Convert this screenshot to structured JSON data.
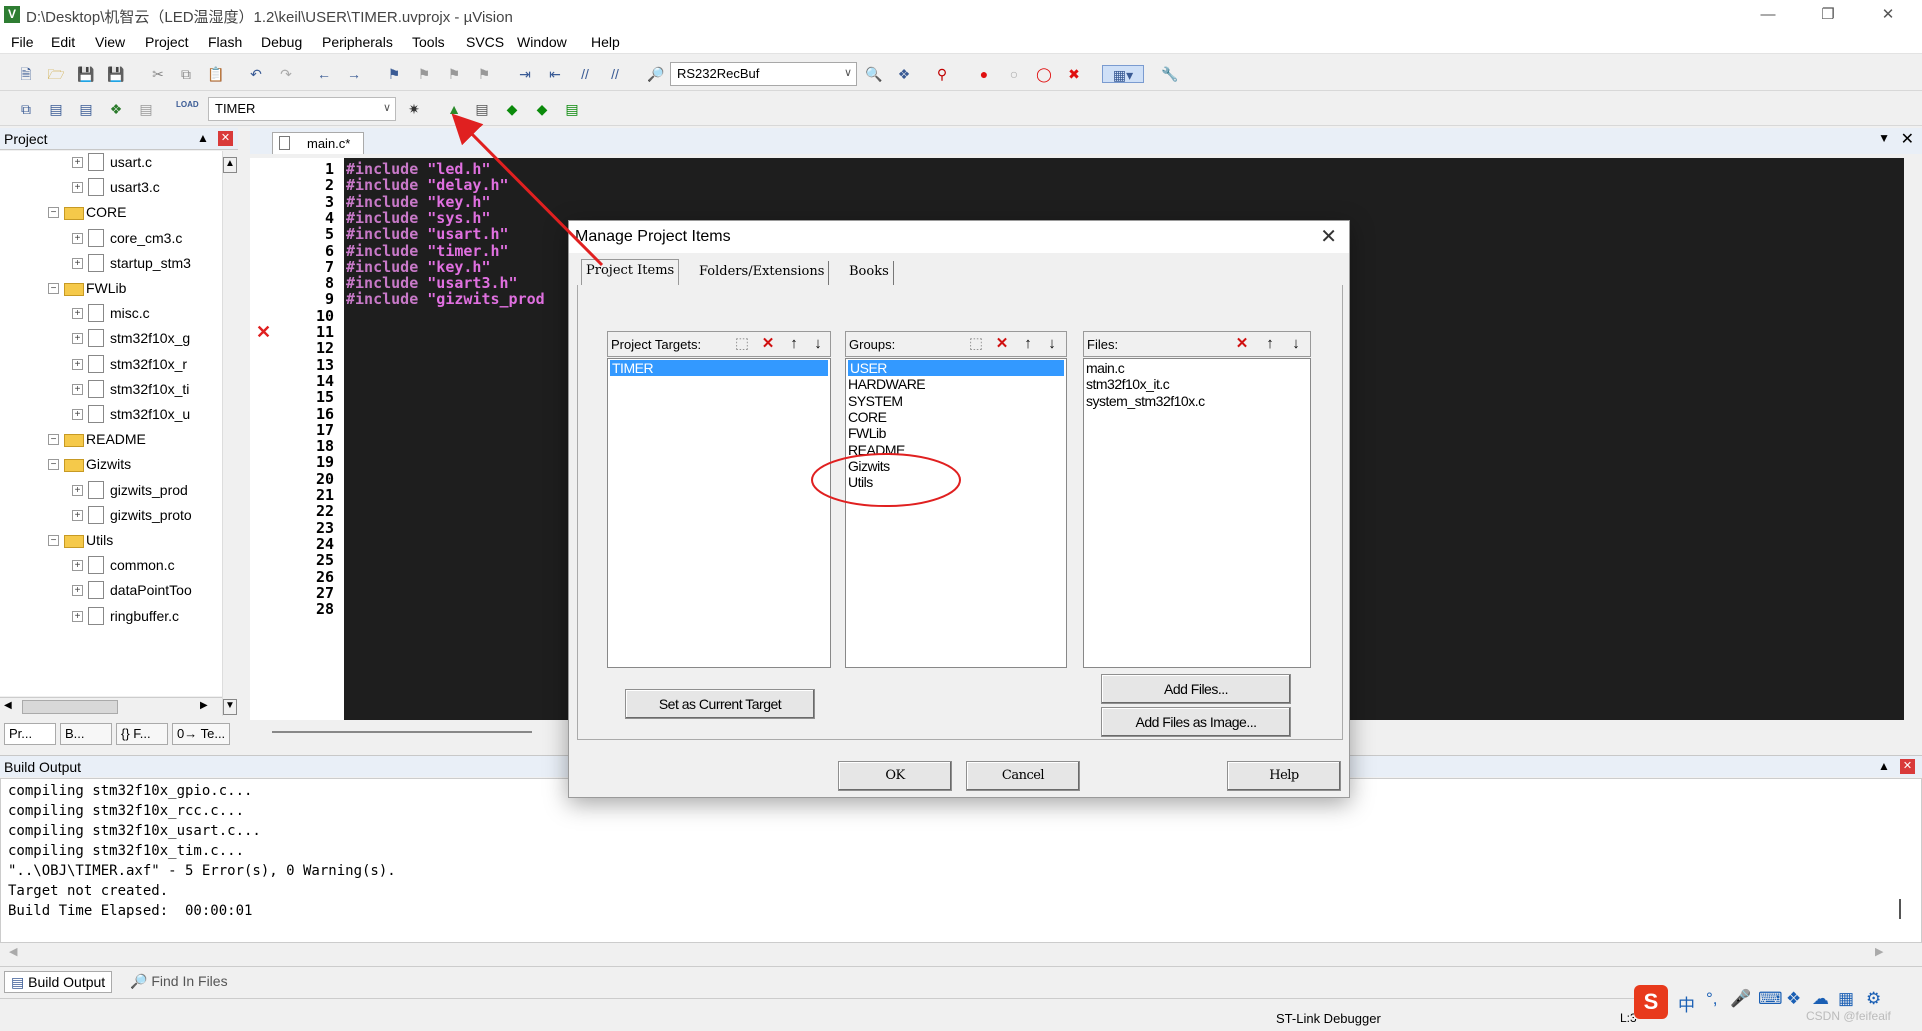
{
  "title_bar": {
    "title": "D:\\Desktop\\机智云（LED温湿度）1.2\\keil\\USER\\TIMER.uvprojx - µVision"
  },
  "menu": [
    "File",
    "Edit",
    "View",
    "Project",
    "Flash",
    "Debug",
    "Peripherals",
    "Tools",
    "SVCS",
    "Window",
    "Help"
  ],
  "toolbar": {
    "find_combo": "RS232RecBuf",
    "target_combo": "TIMER",
    "load_label": "LOAD"
  },
  "project_pane": {
    "title": "Project",
    "tree": [
      {
        "label": "usart.c",
        "level": 2,
        "kind": "file"
      },
      {
        "label": "usart3.c",
        "level": 2,
        "kind": "file"
      },
      {
        "label": "CORE",
        "level": 1,
        "kind": "folder"
      },
      {
        "label": "core_cm3.c",
        "level": 2,
        "kind": "file"
      },
      {
        "label": "startup_stm3",
        "level": 2,
        "kind": "file"
      },
      {
        "label": "FWLib",
        "level": 1,
        "kind": "folder"
      },
      {
        "label": "misc.c",
        "level": 2,
        "kind": "file"
      },
      {
        "label": "stm32f10x_g",
        "level": 2,
        "kind": "file"
      },
      {
        "label": "stm32f10x_r",
        "level": 2,
        "kind": "file"
      },
      {
        "label": "stm32f10x_ti",
        "level": 2,
        "kind": "file"
      },
      {
        "label": "stm32f10x_u",
        "level": 2,
        "kind": "file"
      },
      {
        "label": "README",
        "level": 1,
        "kind": "folder"
      },
      {
        "label": "Gizwits",
        "level": 1,
        "kind": "folder"
      },
      {
        "label": "gizwits_prod",
        "level": 2,
        "kind": "file"
      },
      {
        "label": "gizwits_proto",
        "level": 2,
        "kind": "file"
      },
      {
        "label": "Utils",
        "level": 1,
        "kind": "folder"
      },
      {
        "label": "common.c",
        "level": 2,
        "kind": "file"
      },
      {
        "label": "dataPointToo",
        "level": 2,
        "kind": "file"
      },
      {
        "label": "ringbuffer.c",
        "level": 2,
        "kind": "file"
      }
    ],
    "tabs": [
      "Pr...",
      "B...",
      "{} F...",
      "0→ Te..."
    ]
  },
  "editor": {
    "tab": "main.c*",
    "lines": [
      {
        "n": "1",
        "kw": "#include",
        "str": "\"led.h\""
      },
      {
        "n": "2",
        "kw": "#include",
        "str": "\"delay.h\""
      },
      {
        "n": "3",
        "kw": "#include",
        "str": "\"key.h\""
      },
      {
        "n": "4",
        "kw": "#include",
        "str": "\"sys.h\""
      },
      {
        "n": "5",
        "kw": "#include",
        "str": "\"usart.h\""
      },
      {
        "n": "6",
        "kw": "#include",
        "str": "\"timer.h\""
      },
      {
        "n": "7",
        "kw": "#include",
        "str": "\"key.h\""
      },
      {
        "n": "8",
        "kw": "#include",
        "str": "\"usart3.h\""
      },
      {
        "n": "9",
        "kw": "#include",
        "str": "\"gizwits_prod"
      },
      {
        "n": "10"
      },
      {
        "n": "11"
      },
      {
        "n": "12"
      },
      {
        "n": "13"
      },
      {
        "n": "14"
      },
      {
        "n": "15"
      },
      {
        "n": "16"
      },
      {
        "n": "17"
      },
      {
        "n": "18"
      },
      {
        "n": "19"
      },
      {
        "n": "20"
      },
      {
        "n": "21"
      },
      {
        "n": "22"
      },
      {
        "n": "23"
      },
      {
        "n": "24"
      },
      {
        "n": "25"
      },
      {
        "n": "26"
      },
      {
        "n": "27"
      },
      {
        "n": "28"
      }
    ]
  },
  "build_output": {
    "title": "Build Output",
    "lines": [
      "compiling stm32f10x_gpio.c...",
      "compiling stm32f10x_rcc.c...",
      "compiling stm32f10x_usart.c...",
      "compiling stm32f10x_tim.c...",
      "\"..\\OBJ\\TIMER.axf\" - 5 Error(s), 0 Warning(s).",
      "Target not created.",
      "Build Time Elapsed:  00:00:01"
    ],
    "tabs": [
      "Build Output",
      "Find In Files"
    ]
  },
  "status_bar": {
    "debugger": "ST-Link Debugger",
    "position": "L:3",
    "watermark": "CSDN @feifeaif",
    "ime": "中"
  },
  "dialog": {
    "title": "Manage Project Items",
    "tabs": [
      "Project Items",
      "Folders/Extensions",
      "Books"
    ],
    "targets": {
      "header": "Project Targets:",
      "items": [
        "TIMER"
      ],
      "selected": 0
    },
    "groups": {
      "header": "Groups:",
      "items": [
        "USER",
        "HARDWARE",
        "SYSTEM",
        "CORE",
        "FWLib",
        "README",
        "Gizwits",
        "Utils"
      ],
      "selected": 0
    },
    "files": {
      "header": "Files:",
      "items": [
        "main.c",
        "stm32f10x_it.c",
        "system_stm32f10x.c"
      ]
    },
    "buttons": {
      "set_target": "Set as Current Target",
      "add_files": "Add Files...",
      "add_files_image": "Add Files as Image...",
      "ok": "OK",
      "cancel": "Cancel",
      "help": "Help"
    }
  },
  "colors": {
    "accent": "#3399ff",
    "annotation": "#e02020",
    "code_bg": "#1e1e1e",
    "code_text": "#e070e0"
  }
}
